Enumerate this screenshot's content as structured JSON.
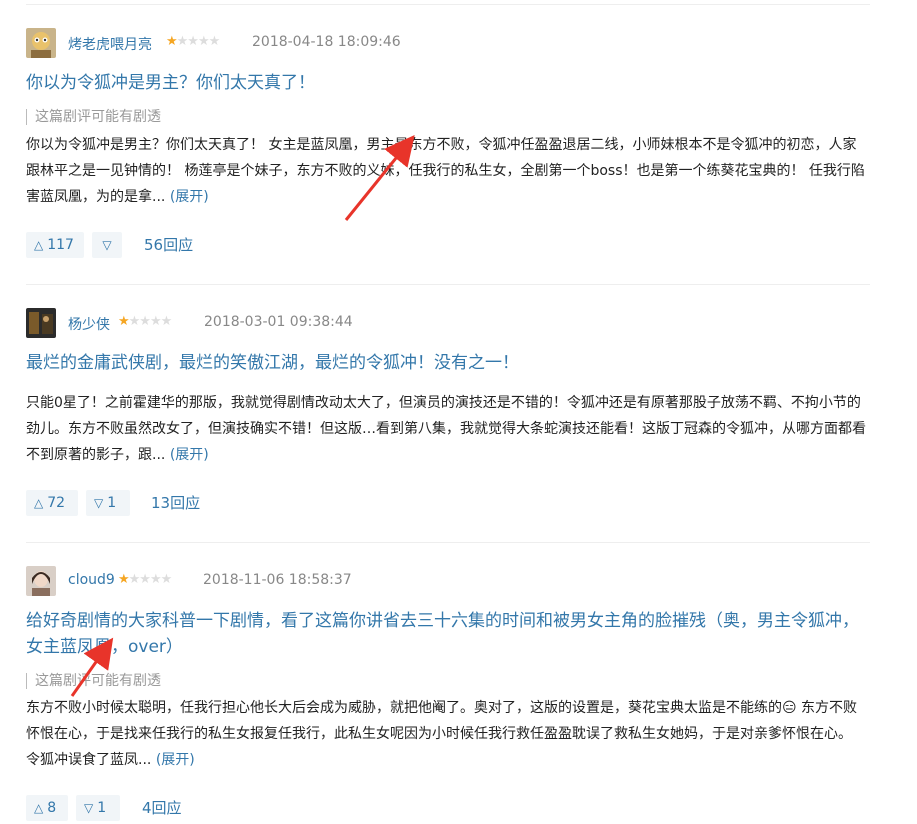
{
  "reviews": [
    {
      "author": "烤老虎喂月亮",
      "rating": 1,
      "time": "2018-04-18 18:09:46",
      "title": "你以为令狐冲是男主？你们太天真了！",
      "spoiler": "这篇剧评可能有剧透",
      "body": "你以为令狐冲是男主？你们太天真了！ 女主是蓝凤凰，男主是东方不败，令狐冲任盈盈退居二线，小师妹根本不是令狐冲的初恋，人家跟林平之是一见钟情的！ 杨莲亭是个妹子，东方不败的义妹，任我行的私生女，全剧第一个boss！也是第一个练葵花宝典的！ 任我行陷害蓝凤凰，为的是拿...",
      "expand": "(展开)",
      "up": "117",
      "down": "",
      "replies": "56回应"
    },
    {
      "author": "杨少侠",
      "rating": 1,
      "time": "2018-03-01 09:38:44",
      "title": "最烂的金庸武侠剧，最烂的笑傲江湖，最烂的令狐冲！没有之一！",
      "spoiler": "",
      "body": "只能0星了！之前霍建华的那版，我就觉得剧情改动太大了，但演员的演技还是不错的！令狐冲还是有原著那股子放荡不羁、不拘小节的劲儿。东方不败虽然改女了，但演技确实不错！但这版…看到第八集，我就觉得大条蛇演技还能看！这版丁冠森的令狐冲，从哪方面都看不到原著的影子，跟...",
      "expand": "(展开)",
      "up": "72",
      "down": "1",
      "replies": "13回应"
    },
    {
      "author": "cloud9",
      "rating": 1,
      "time": "2018-11-06 18:58:37",
      "title": "给好奇剧情的大家科普一下剧情，看了这篇你讲省去三十六集的时间和被男女主角的脸摧残（奥，男主令狐冲，女主蓝凤凰，over）",
      "spoiler": "这篇剧评可能有剧透",
      "body": "东方不败小时候太聪明，任我行担心他长大后会成为威胁，就把他阉了。奥对了，这版的设置是，葵花宝典太监是不能练的😑 东方不败怀恨在心，于是找来任我行的私生女报复任我行，此私生女呢因为小时候任我行救任盈盈耽误了救私生女她妈，于是对亲爹怀恨在心。 令狐冲误食了蓝凤...",
      "expand": "(展开)",
      "up": "8",
      "down": "1",
      "replies": "4回应"
    }
  ],
  "colors": {
    "link": "#3377aa",
    "star_on": "#f5a623",
    "star_off": "#dddddd",
    "annotation_arrow": "#e8342a",
    "vote_bg": "#f1f5f8"
  },
  "icons": {
    "star": "★",
    "up": "up-triangle-icon",
    "down": "down-triangle-icon"
  }
}
